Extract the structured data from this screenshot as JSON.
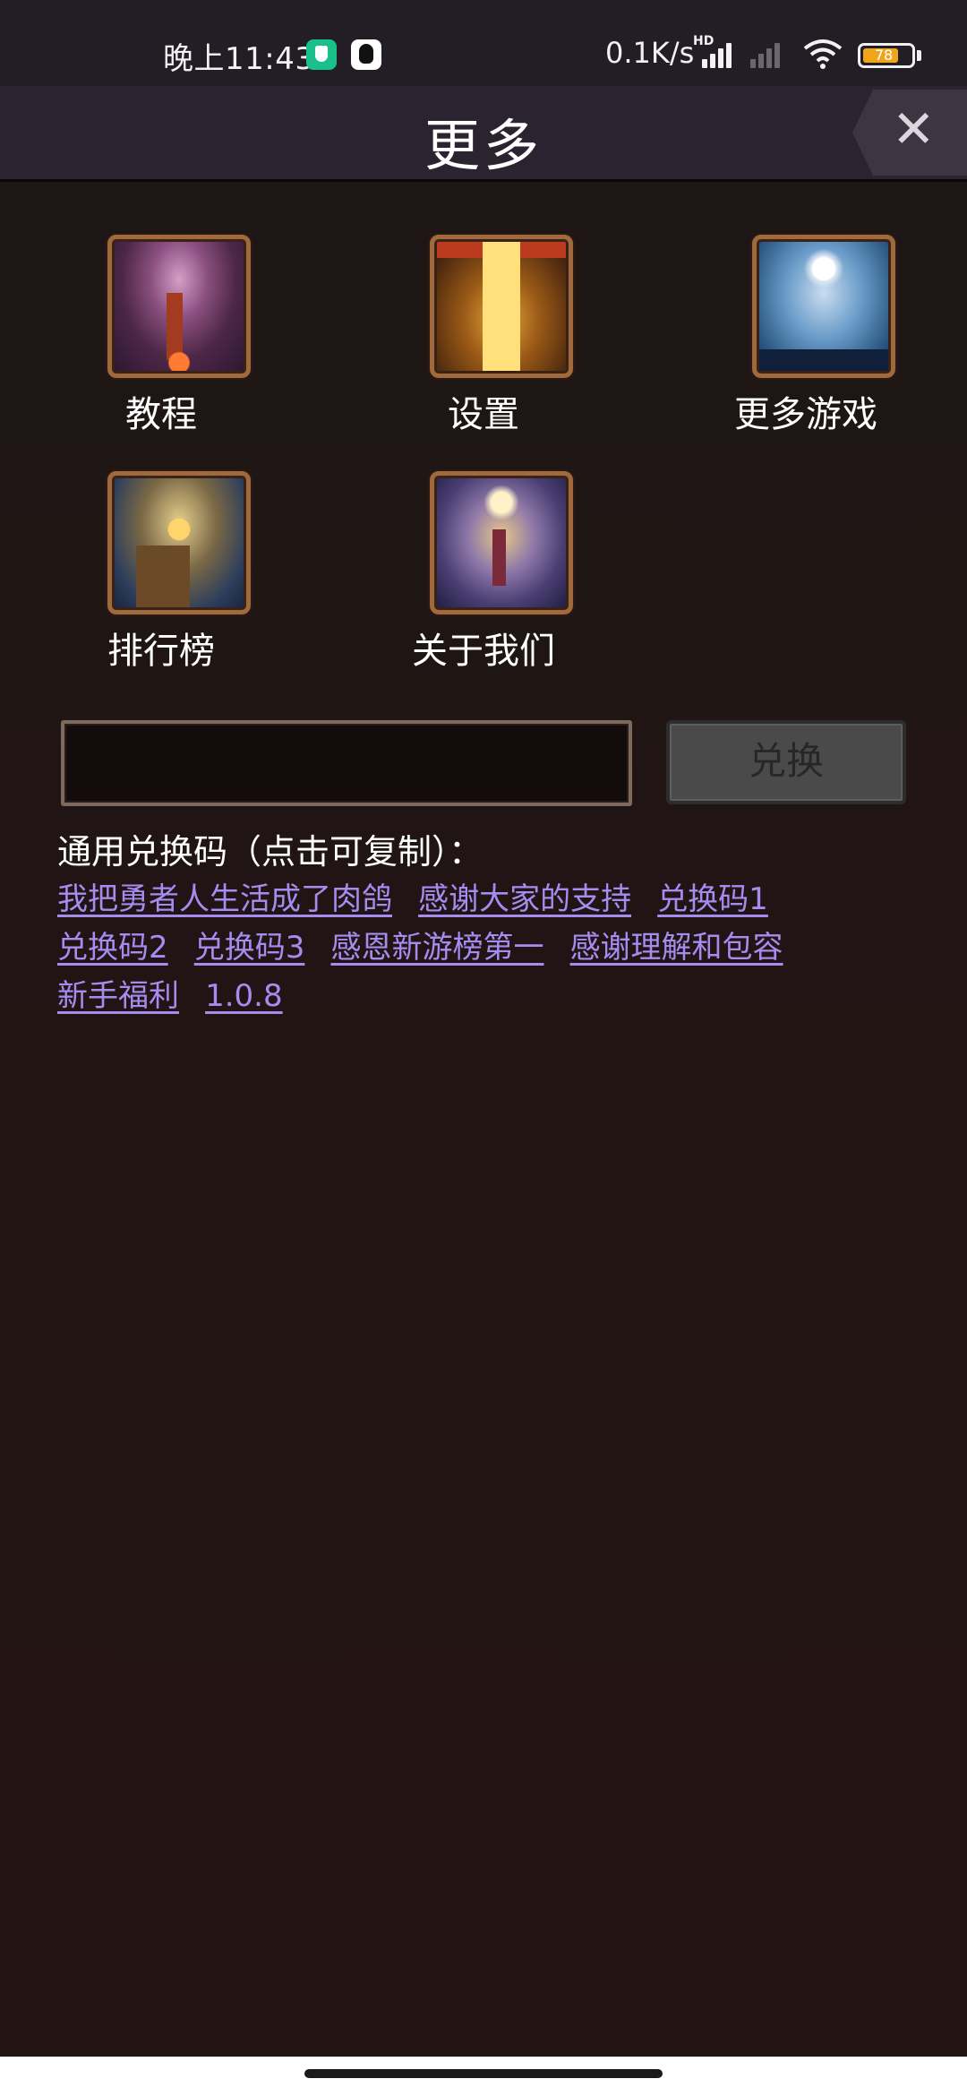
{
  "status_bar": {
    "time": "晚上11:43",
    "network_speed": "0.1K/s",
    "network_type": "HD",
    "battery_level": "78",
    "icons": [
      "shield-app-icon",
      "qq-icon",
      "signal-icon",
      "signal-weak-icon",
      "wifi-icon",
      "battery-icon"
    ]
  },
  "header": {
    "title": "更多",
    "close_icon": "✕"
  },
  "menu": {
    "items": [
      {
        "label": "教程"
      },
      {
        "label": "设置"
      },
      {
        "label": "更多游戏"
      },
      {
        "label": "排行榜"
      },
      {
        "label": "关于我们"
      }
    ]
  },
  "redeem": {
    "input_value": "",
    "input_placeholder": "",
    "button_label": "兑换"
  },
  "codes": {
    "title": "通用兑换码（点击可复制）：",
    "rows": [
      [
        "我把勇者人生活成了肉鸽",
        "感谢大家的支持",
        "兑换码1"
      ],
      [
        "兑换码2",
        "兑换码3",
        "感恩新游榜第一",
        "感谢理解和包容"
      ],
      [
        "新手福利",
        "1.0.8"
      ]
    ]
  },
  "colors": {
    "background": "#211513",
    "header": "#2b2430",
    "link": "#a78cf0",
    "frame": "#a06a3c",
    "button_disabled": "#4a4a4a"
  }
}
